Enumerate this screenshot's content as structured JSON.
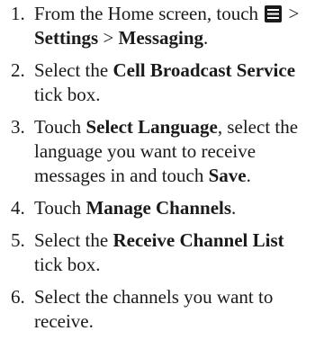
{
  "steps": [
    {
      "num": "1.",
      "parts": {
        "a": "From the Home screen, touch ",
        "icon": "menu-icon",
        "b": " > ",
        "c": "Settings",
        "d": " > ",
        "e": "Messaging",
        "f": "."
      }
    },
    {
      "num": "2.",
      "parts": {
        "a": "Select the ",
        "b": "Cell Broadcast Service",
        "c": " tick box."
      }
    },
    {
      "num": "3.",
      "parts": {
        "a": "Touch ",
        "b": "Select Language",
        "c": ", select the language you want to receive messages in and touch ",
        "d": "Save",
        "e": "."
      }
    },
    {
      "num": "4.",
      "parts": {
        "a": "Touch ",
        "b": "Manage Channels",
        "c": "."
      }
    },
    {
      "num": "5.",
      "parts": {
        "a": "Select the ",
        "b": "Receive Channel List",
        "c": " tick box."
      }
    },
    {
      "num": "6.",
      "parts": {
        "a": "Select the channels you want to receive."
      }
    }
  ]
}
